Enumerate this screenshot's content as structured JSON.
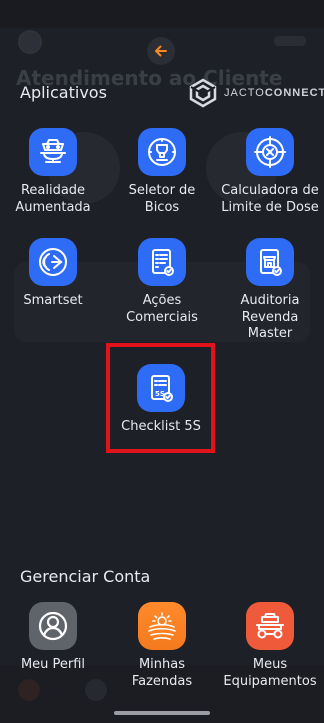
{
  "background": {
    "greeting": "Atendimento ao Cliente"
  },
  "logo": {
    "text_light": "JACTO",
    "text_bold": "CONNECT"
  },
  "apps_section": {
    "title": "Aplicativos",
    "items": [
      {
        "label": "Realidade\nAumentada",
        "icon": "ar-sprayer-icon"
      },
      {
        "label": "Seletor de\nBicos",
        "icon": "nozzle-selector-icon"
      },
      {
        "label": "Calculadora de\nLimite de Dose",
        "icon": "crosshair-calculator-icon"
      },
      {
        "label": "Smartset",
        "icon": "smartset-icon"
      },
      {
        "label": "Ações\nComerciais",
        "icon": "checklist-document-icon"
      },
      {
        "label": "Auditoria\nRevenda\nMaster",
        "icon": "storefront-audit-icon"
      },
      {
        "label": "Checklist 5S",
        "icon": "checklist-5s-icon"
      }
    ]
  },
  "account_section": {
    "title": "Gerenciar Conta",
    "items": [
      {
        "label": "Meu Perfil",
        "icon": "user-profile-icon"
      },
      {
        "label": "Minhas\nFazendas",
        "icon": "farm-icon"
      },
      {
        "label": "Meus\nEquipamentos",
        "icon": "equipment-icon"
      }
    ]
  },
  "colors": {
    "background": "#1d2026",
    "app_blue": "#2f6cf5",
    "highlight_red": "#e0121a"
  }
}
